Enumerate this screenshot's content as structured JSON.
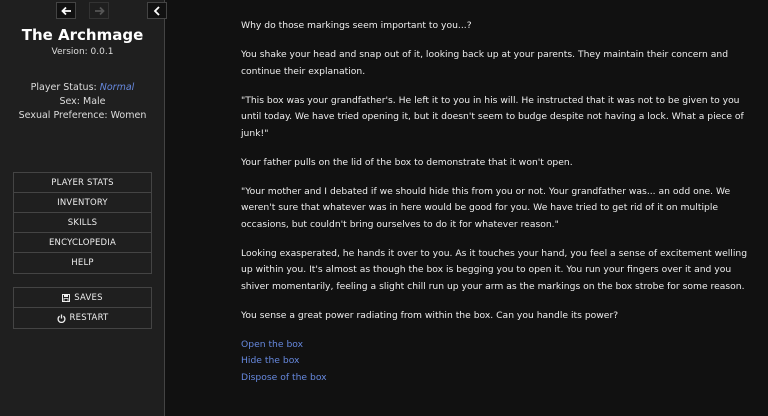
{
  "history": {
    "back_icon": "arrow-left-icon",
    "forward_icon": "arrow-right-icon",
    "toggle_icon": "chevron-left-icon"
  },
  "story": {
    "title": "The Archmage",
    "version": "Version: 0.0.1"
  },
  "player": {
    "status_label": "Player Status:",
    "status_value": "Normal",
    "sex": "Sex: Male",
    "preference": "Sexual Preference: Women"
  },
  "menu": [
    {
      "label": "PLAYER STATS"
    },
    {
      "label": "INVENTORY"
    },
    {
      "label": "SKILLS"
    },
    {
      "label": "ENCYCLOPEDIA"
    },
    {
      "label": "HELP"
    }
  ],
  "system_menu": [
    {
      "label": "SAVES",
      "icon": "save-icon"
    },
    {
      "label": "RESTART",
      "icon": "power-icon"
    }
  ],
  "passage": {
    "paragraphs": [
      "Why do those markings seem important to you...?",
      "You shake your head and snap out of it, looking back up at your parents. They maintain their concern and continue their explanation.",
      "\"This box was your grandfather's. He left it to you in his will. He instructed that it was not to be given to you until today. We have tried opening it, but it doesn't seem to budge despite not having a lock. What a piece of junk!\"",
      "Your father pulls on the lid of the box to demonstrate that it won't open.",
      "\"Your mother and I debated if we should hide this from you or not. Your grandfather was... an odd one. We weren't sure that whatever was in here would be good for you. We have tried to get rid of it on multiple occasions, but couldn't bring ourselves to do it for whatever reason.\"",
      "Looking exasperated, he hands it over to you. As it touches your hand, you feel a sense of excitement welling up within you. It's almost as though the box is begging you to open it. You run your fingers over it and you shiver momentarily, feeling a slight chill run up your arm as the markings on the box strobe for some reason.",
      "You sense a great power radiating from within the box. Can you handle its power?"
    ],
    "choices": [
      "Open the box",
      "Hide the box",
      "Dispose of the box"
    ]
  },
  "colors": {
    "link": "#6688dd",
    "background": "#111111",
    "sidebar": "#1f1f1f"
  }
}
